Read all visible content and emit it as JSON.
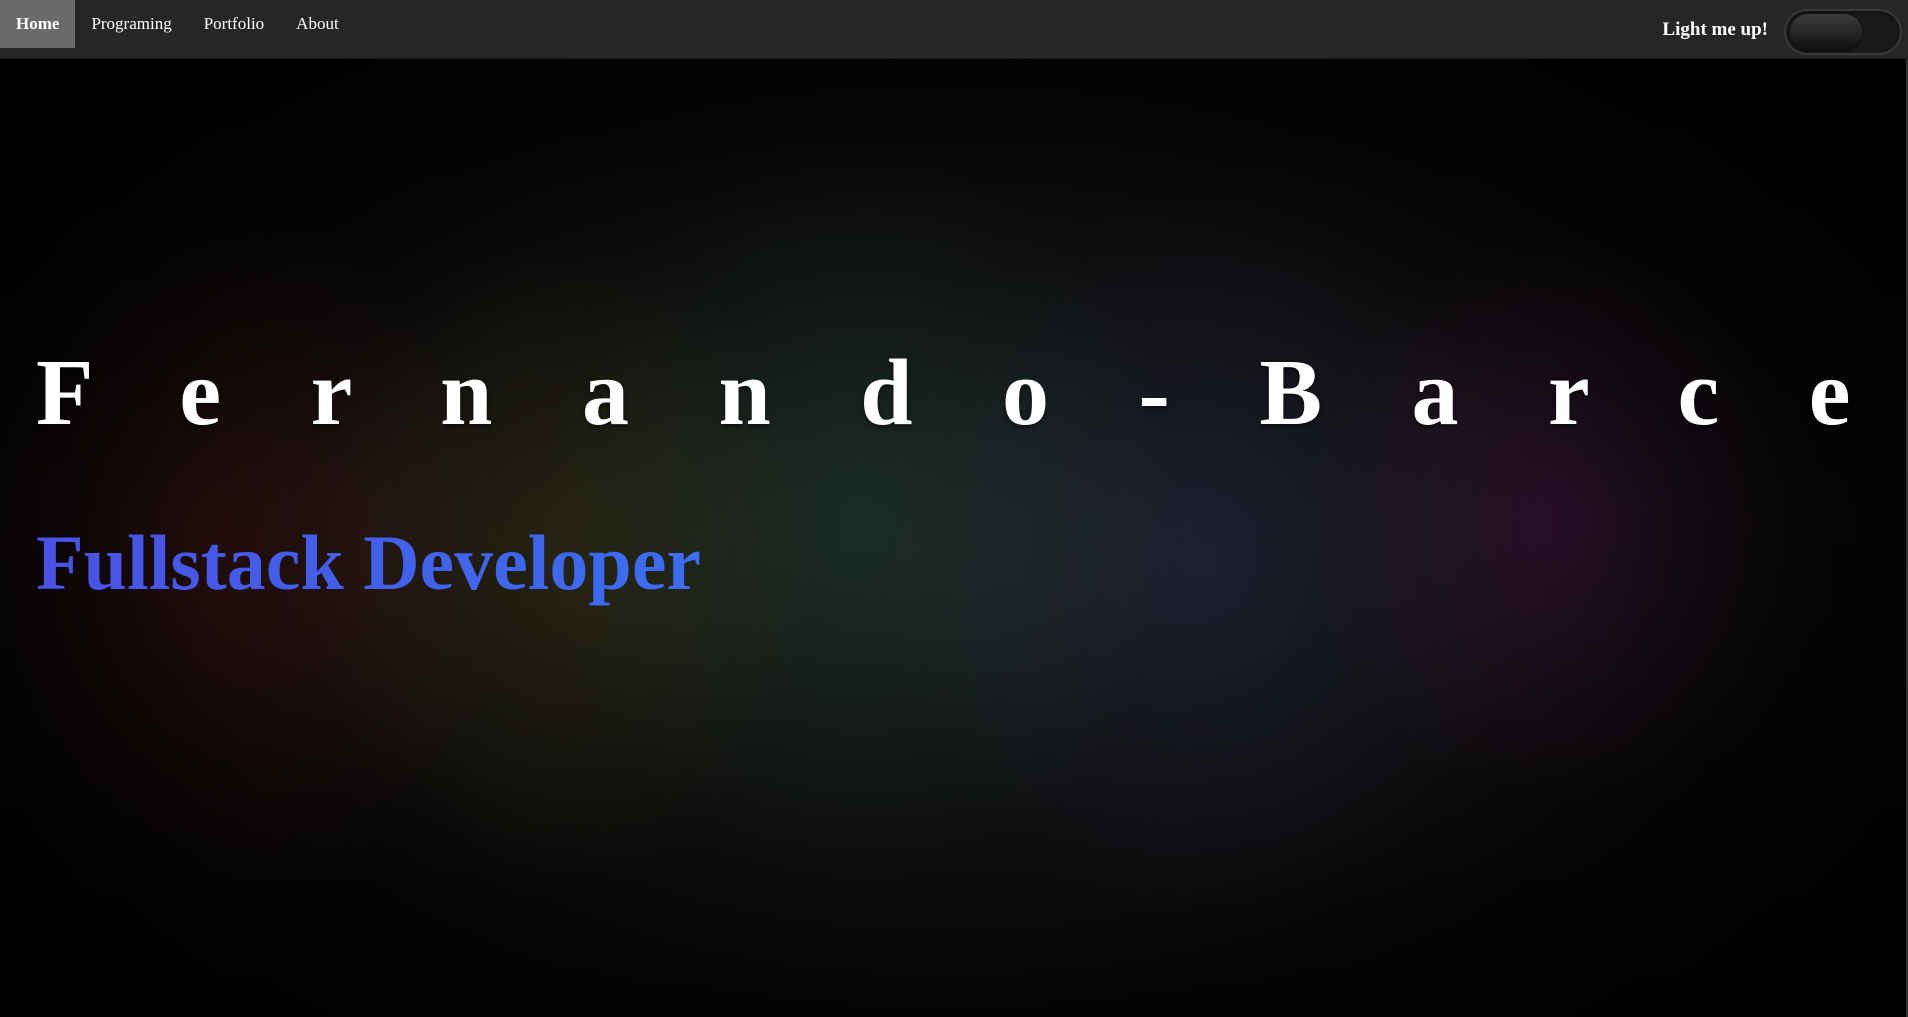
{
  "nav": {
    "items": [
      {
        "label": "Home",
        "active": true
      },
      {
        "label": "Programing",
        "active": false
      },
      {
        "label": "Portfolio",
        "active": false
      },
      {
        "label": "About",
        "active": false
      }
    ]
  },
  "theme_toggle": {
    "label": "Light me up!",
    "state": "off"
  },
  "hero": {
    "name": "F e r n a n d o - B a r c e n a s",
    "role": "Fullstack Developer"
  },
  "colors": {
    "navbar": "#262626",
    "active_nav": "#6a6a6a",
    "role_text": "#3b63e8",
    "name_text": "#ffffff"
  }
}
